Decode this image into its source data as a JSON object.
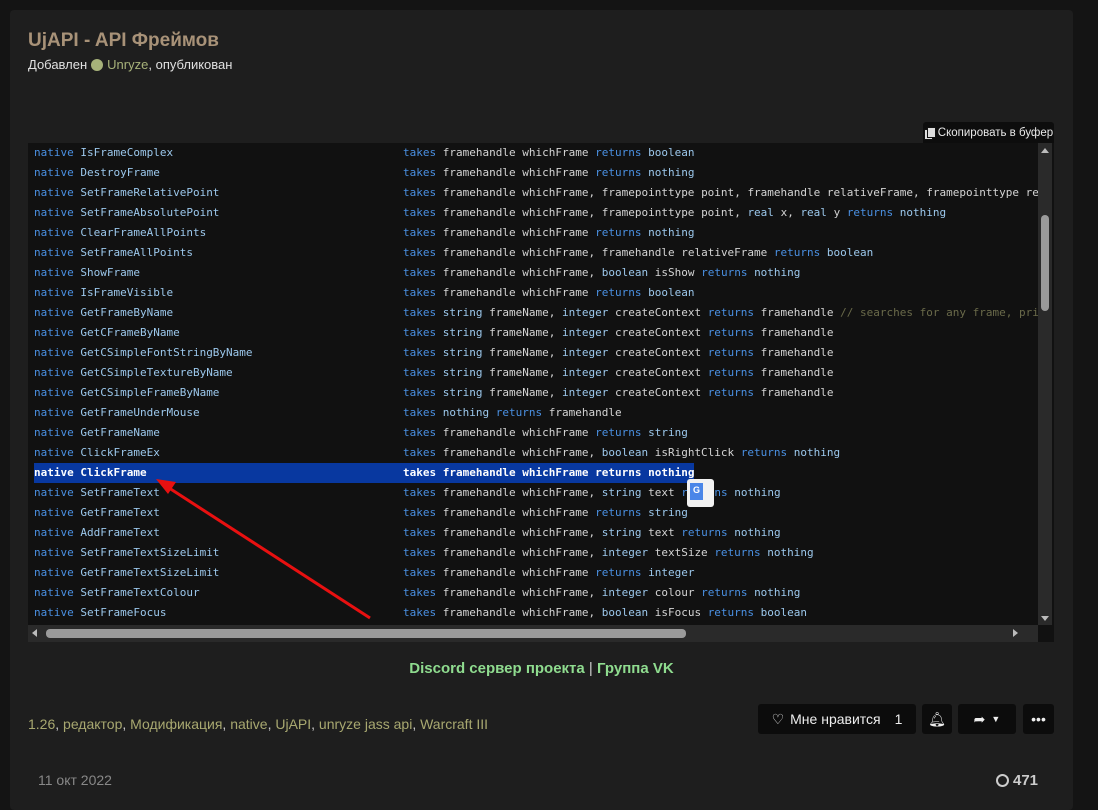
{
  "post": {
    "title": "UjAPI - API Фреймов",
    "added_label": "Добавлен",
    "author": "Unryze",
    "published_label": ", опубликован"
  },
  "code": {
    "copy_label": "Скопировать в буфер",
    "selected_line": 16,
    "lines": [
      {
        "name": "IsFrameComplex",
        "sig": "takes framehandle whichFrame returns boolean"
      },
      {
        "name": "DestroyFrame",
        "sig": "takes framehandle whichFrame returns nothing"
      },
      {
        "name": "SetFrameRelativePoint",
        "sig": "takes framehandle whichFrame, framepointtype point, framehandle relativeFrame, framepointtype re"
      },
      {
        "name": "SetFrameAbsolutePoint",
        "sig": "takes framehandle whichFrame, framepointtype point, real x, real y returns nothing"
      },
      {
        "name": "ClearFrameAllPoints",
        "sig": "takes framehandle whichFrame returns nothing"
      },
      {
        "name": "SetFrameAllPoints",
        "sig": "takes framehandle whichFrame, framehandle relativeFrame returns boolean"
      },
      {
        "name": "ShowFrame",
        "sig": "takes framehandle whichFrame, boolean isShow returns nothing"
      },
      {
        "name": "IsFrameVisible",
        "sig": "takes framehandle whichFrame returns boolean"
      },
      {
        "name": "GetFrameByName",
        "sig": "takes string frameName, integer createContext returns framehandle",
        "comment": "// searches for any frame, pri"
      },
      {
        "name": "GetCFrameByName",
        "sig": "takes string frameName, integer createContext returns framehandle"
      },
      {
        "name": "GetCSimpleFontStringByName",
        "sig": "takes string frameName, integer createContext returns framehandle"
      },
      {
        "name": "GetCSimpleTextureByName",
        "sig": "takes string frameName, integer createContext returns framehandle"
      },
      {
        "name": "GetCSimpleFrameByName",
        "sig": "takes string frameName, integer createContext returns framehandle"
      },
      {
        "name": "GetFrameUnderMouse",
        "sig": "takes nothing returns framehandle"
      },
      {
        "name": "GetFrameName",
        "sig": "takes framehandle whichFrame returns string"
      },
      {
        "name": "ClickFrameEx",
        "sig": "takes framehandle whichFrame, boolean isRightClick returns nothing"
      },
      {
        "name": "ClickFrame",
        "sig": "takes framehandle whichFrame returns nothing"
      },
      {
        "name": "SetFrameText",
        "sig": "takes framehandle whichFrame, string text returns nothing"
      },
      {
        "name": "GetFrameText",
        "sig": "takes framehandle whichFrame returns string"
      },
      {
        "name": "AddFrameText",
        "sig": "takes framehandle whichFrame, string text returns nothing"
      },
      {
        "name": "SetFrameTextSizeLimit",
        "sig": "takes framehandle whichFrame, integer textSize returns nothing"
      },
      {
        "name": "GetFrameTextSizeLimit",
        "sig": "takes framehandle whichFrame returns integer"
      },
      {
        "name": "SetFrameTextColour",
        "sig": "takes framehandle whichFrame, integer colour returns nothing"
      },
      {
        "name": "SetFrameFocus",
        "sig": "takes framehandle whichFrame, boolean isFocus returns boolean"
      }
    ]
  },
  "links": {
    "discord": "Discord сервер проекта",
    "separator": "|",
    "vk": "Группа VK"
  },
  "tags": [
    "1.26",
    "редактор",
    "Модификация",
    "native",
    "UjAPI",
    "unryze jass api",
    "Warcraft III"
  ],
  "actions": {
    "like_label": "Мне нравится",
    "like_count": "1"
  },
  "footer": {
    "date": "11 окт 2022",
    "views": "471"
  },
  "colors": {
    "keyword": "#4a90e2",
    "type": "#9cc8ec",
    "selection": "#0838a0",
    "link": "#8fdc8f",
    "annotation_arrow": "#e81010"
  }
}
